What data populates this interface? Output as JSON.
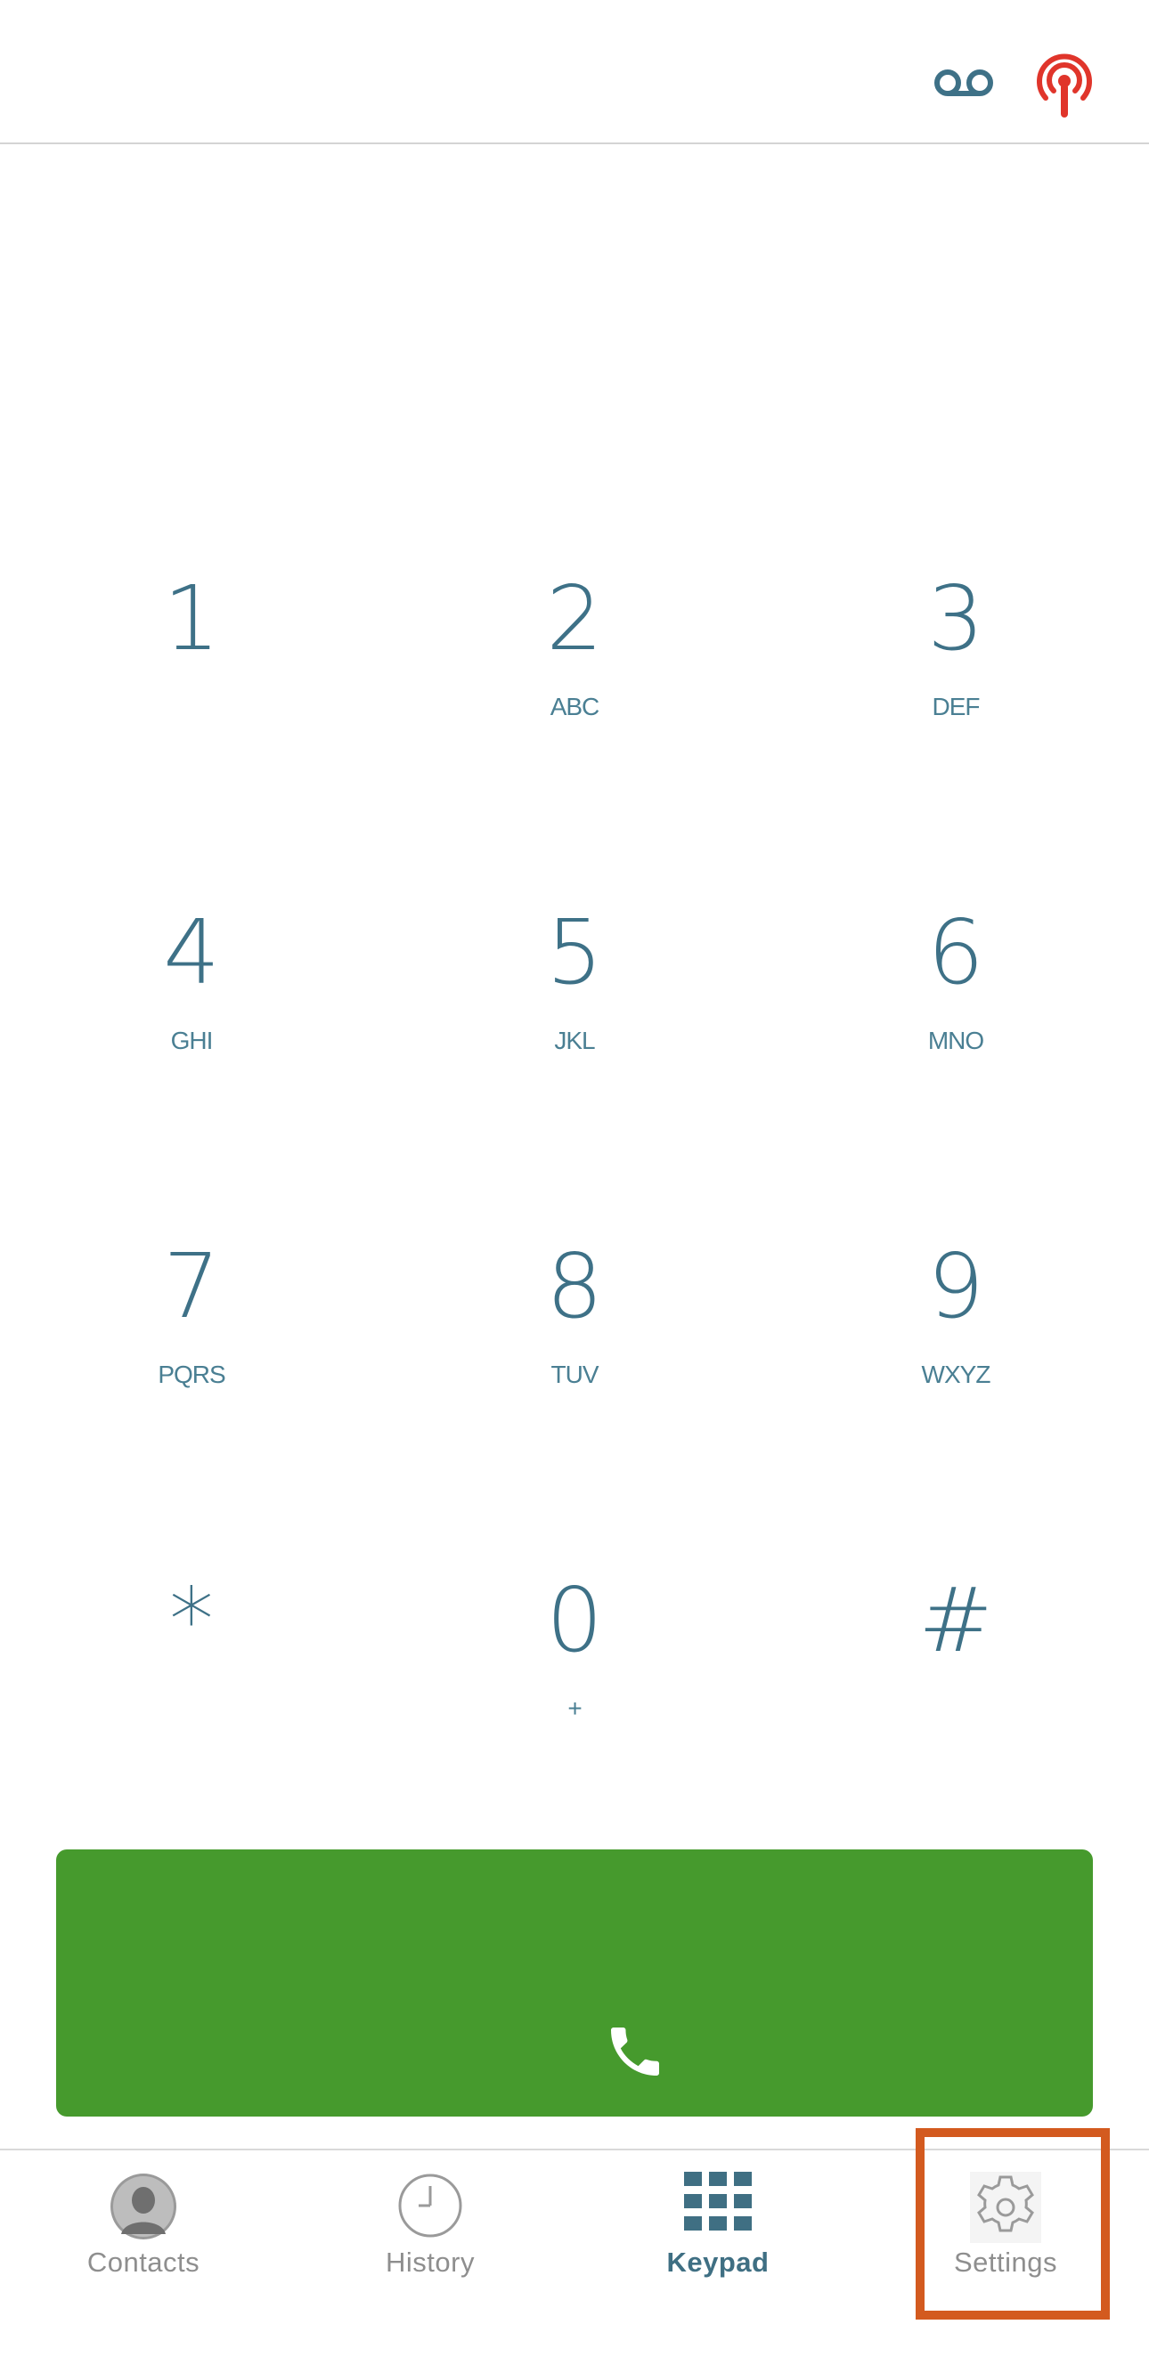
{
  "header": {
    "voicemail_icon": "voicemail-icon",
    "broadcast_icon": "broadcast-icon"
  },
  "keypad": {
    "keys": [
      {
        "digit": "1",
        "letters": ""
      },
      {
        "digit": "2",
        "letters": "ABC"
      },
      {
        "digit": "3",
        "letters": "DEF"
      },
      {
        "digit": "4",
        "letters": "GHI"
      },
      {
        "digit": "5",
        "letters": "JKL"
      },
      {
        "digit": "6",
        "letters": "MNO"
      },
      {
        "digit": "7",
        "letters": "PQRS"
      },
      {
        "digit": "8",
        "letters": "TUV"
      },
      {
        "digit": "9",
        "letters": "WXYZ"
      },
      {
        "digit": "*",
        "letters": ""
      },
      {
        "digit": "0",
        "letters": "+"
      },
      {
        "digit": "#",
        "letters": ""
      }
    ]
  },
  "call_button": {
    "icon": "phone-icon",
    "color": "#469a2d"
  },
  "tabs": [
    {
      "label": "Contacts",
      "icon": "contacts-icon",
      "active": false
    },
    {
      "label": "History",
      "icon": "clock-icon",
      "active": false
    },
    {
      "label": "Keypad",
      "icon": "keypad-grid-icon",
      "active": true
    },
    {
      "label": "Settings",
      "icon": "gear-icon",
      "active": false
    }
  ],
  "colors": {
    "accent": "#3e7187",
    "call_green": "#469a2d",
    "broadcast_red": "#e0352b",
    "highlight": "#d35a1f"
  }
}
